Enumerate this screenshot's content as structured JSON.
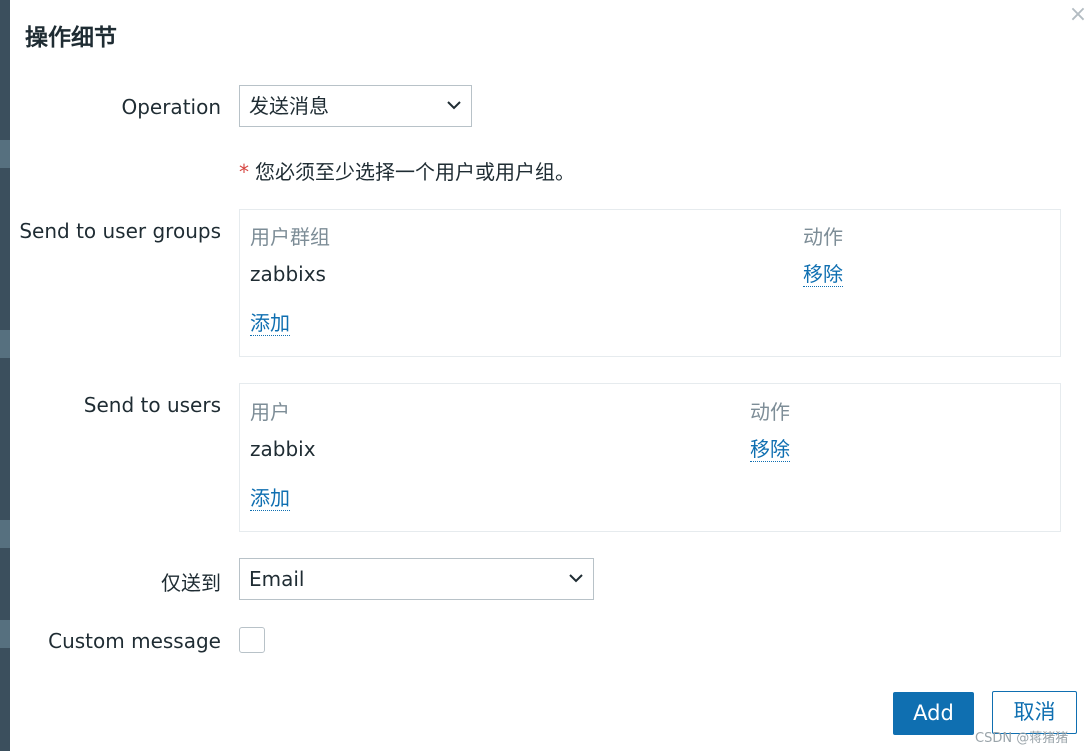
{
  "dialog": {
    "title": "操作细节",
    "close_label": "×"
  },
  "operation": {
    "label": "Operation",
    "selected": "发送消息"
  },
  "required_note": {
    "star": "*",
    "text": "您必须至少选择一个用户或用户组。"
  },
  "user_groups": {
    "label": "Send to user groups",
    "col_name": "用户群组",
    "col_action": "动作",
    "rows": [
      {
        "name": "zabbixs",
        "action": "移除"
      }
    ],
    "add_label": "添加"
  },
  "users": {
    "label": "Send to users",
    "col_name": "用户",
    "col_action": "动作",
    "rows": [
      {
        "name": "zabbix",
        "action": "移除"
      }
    ],
    "add_label": "添加"
  },
  "send_only_to": {
    "label": "仅送到",
    "selected": "Email"
  },
  "custom_message": {
    "label": "Custom message",
    "checked": false
  },
  "buttons": {
    "add": "Add",
    "cancel": "取消"
  },
  "watermark": "CSDN @蒋猪猪",
  "colors": {
    "primary": "#0f6fb1",
    "required": "#d64541",
    "muted": "#7d8d97"
  },
  "icons": {
    "close": "close-icon",
    "dropdown": "chevron-down-icon"
  }
}
